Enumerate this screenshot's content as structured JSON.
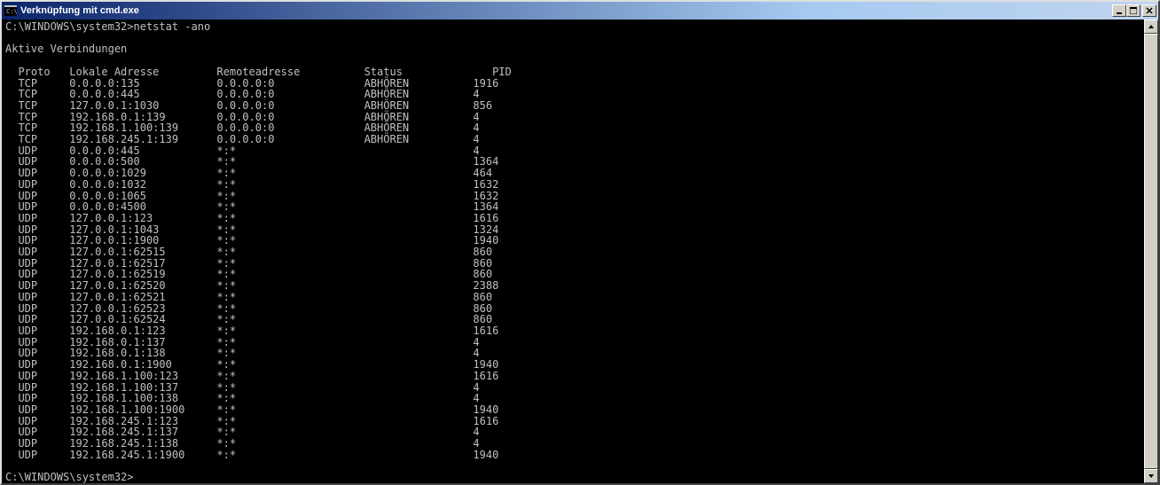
{
  "window": {
    "title": "Verknüpfung mit cmd.exe",
    "icon": "cmd-icon"
  },
  "terminal": {
    "prompt1": "C:\\WINDOWS\\system32>netstat -ano",
    "blank": "",
    "header_line": "Aktive Verbindungen",
    "columns": {
      "proto": "Proto",
      "local": "Lokale Adresse",
      "remote": "Remoteadresse",
      "status": "Status",
      "pid": "PID"
    },
    "rows": [
      {
        "proto": "TCP",
        "local": "0.0.0.0:135",
        "remote": "0.0.0.0:0",
        "status": "ABHÖREN",
        "pid": "1916"
      },
      {
        "proto": "TCP",
        "local": "0.0.0.0:445",
        "remote": "0.0.0.0:0",
        "status": "ABHÖREN",
        "pid": "4"
      },
      {
        "proto": "TCP",
        "local": "127.0.0.1:1030",
        "remote": "0.0.0.0:0",
        "status": "ABHÖREN",
        "pid": "856"
      },
      {
        "proto": "TCP",
        "local": "192.168.0.1:139",
        "remote": "0.0.0.0:0",
        "status": "ABHÖREN",
        "pid": "4"
      },
      {
        "proto": "TCP",
        "local": "192.168.1.100:139",
        "remote": "0.0.0.0:0",
        "status": "ABHÖREN",
        "pid": "4"
      },
      {
        "proto": "TCP",
        "local": "192.168.245.1:139",
        "remote": "0.0.0.0:0",
        "status": "ABHÖREN",
        "pid": "4"
      },
      {
        "proto": "UDP",
        "local": "0.0.0.0:445",
        "remote": "*:*",
        "status": "",
        "pid": "4"
      },
      {
        "proto": "UDP",
        "local": "0.0.0.0:500",
        "remote": "*:*",
        "status": "",
        "pid": "1364"
      },
      {
        "proto": "UDP",
        "local": "0.0.0.0:1029",
        "remote": "*:*",
        "status": "",
        "pid": "464"
      },
      {
        "proto": "UDP",
        "local": "0.0.0.0:1032",
        "remote": "*:*",
        "status": "",
        "pid": "1632"
      },
      {
        "proto": "UDP",
        "local": "0.0.0.0:1065",
        "remote": "*:*",
        "status": "",
        "pid": "1632"
      },
      {
        "proto": "UDP",
        "local": "0.0.0.0:4500",
        "remote": "*:*",
        "status": "",
        "pid": "1364"
      },
      {
        "proto": "UDP",
        "local": "127.0.0.1:123",
        "remote": "*:*",
        "status": "",
        "pid": "1616"
      },
      {
        "proto": "UDP",
        "local": "127.0.0.1:1043",
        "remote": "*:*",
        "status": "",
        "pid": "1324"
      },
      {
        "proto": "UDP",
        "local": "127.0.0.1:1900",
        "remote": "*:*",
        "status": "",
        "pid": "1940"
      },
      {
        "proto": "UDP",
        "local": "127.0.0.1:62515",
        "remote": "*:*",
        "status": "",
        "pid": "860"
      },
      {
        "proto": "UDP",
        "local": "127.0.0.1:62517",
        "remote": "*:*",
        "status": "",
        "pid": "860"
      },
      {
        "proto": "UDP",
        "local": "127.0.0.1:62519",
        "remote": "*:*",
        "status": "",
        "pid": "860"
      },
      {
        "proto": "UDP",
        "local": "127.0.0.1:62520",
        "remote": "*:*",
        "status": "",
        "pid": "2388"
      },
      {
        "proto": "UDP",
        "local": "127.0.0.1:62521",
        "remote": "*:*",
        "status": "",
        "pid": "860"
      },
      {
        "proto": "UDP",
        "local": "127.0.0.1:62523",
        "remote": "*:*",
        "status": "",
        "pid": "860"
      },
      {
        "proto": "UDP",
        "local": "127.0.0.1:62524",
        "remote": "*:*",
        "status": "",
        "pid": "860"
      },
      {
        "proto": "UDP",
        "local": "192.168.0.1:123",
        "remote": "*:*",
        "status": "",
        "pid": "1616"
      },
      {
        "proto": "UDP",
        "local": "192.168.0.1:137",
        "remote": "*:*",
        "status": "",
        "pid": "4"
      },
      {
        "proto": "UDP",
        "local": "192.168.0.1:138",
        "remote": "*:*",
        "status": "",
        "pid": "4"
      },
      {
        "proto": "UDP",
        "local": "192.168.0.1:1900",
        "remote": "*:*",
        "status": "",
        "pid": "1940"
      },
      {
        "proto": "UDP",
        "local": "192.168.1.100:123",
        "remote": "*:*",
        "status": "",
        "pid": "1616"
      },
      {
        "proto": "UDP",
        "local": "192.168.1.100:137",
        "remote": "*:*",
        "status": "",
        "pid": "4"
      },
      {
        "proto": "UDP",
        "local": "192.168.1.100:138",
        "remote": "*:*",
        "status": "",
        "pid": "4"
      },
      {
        "proto": "UDP",
        "local": "192.168.1.100:1900",
        "remote": "*:*",
        "status": "",
        "pid": "1940"
      },
      {
        "proto": "UDP",
        "local": "192.168.245.1:123",
        "remote": "*:*",
        "status": "",
        "pid": "1616"
      },
      {
        "proto": "UDP",
        "local": "192.168.245.1:137",
        "remote": "*:*",
        "status": "",
        "pid": "4"
      },
      {
        "proto": "UDP",
        "local": "192.168.245.1:138",
        "remote": "*:*",
        "status": "",
        "pid": "4"
      },
      {
        "proto": "UDP",
        "local": "192.168.245.1:1900",
        "remote": "*:*",
        "status": "",
        "pid": "1940"
      }
    ],
    "prompt2": "C:\\WINDOWS\\system32>"
  }
}
